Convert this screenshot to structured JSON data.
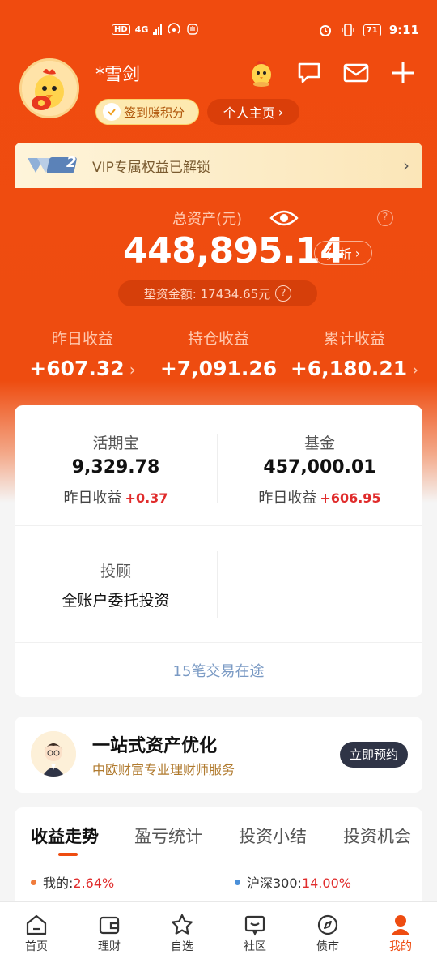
{
  "status_bar": {
    "hd": "HD",
    "network": "4G",
    "time": "9:11",
    "battery": "71"
  },
  "header": {
    "username": "*雪剑",
    "checkin_label": "签到赚积分",
    "profile_label": "个人主页"
  },
  "vip": {
    "level": "2",
    "text": "VIP专属权益已解锁"
  },
  "assets": {
    "total_label": "总资产(元)",
    "total_value": "448,895.14",
    "analyze_label": "分析",
    "margin_text": "垫资金额: 17434.65元",
    "yesterday_label": "昨日收益",
    "yesterday_value": "+607.32",
    "holding_label": "持仓收益",
    "holding_value": "+7,091.26",
    "cumulative_label": "累计收益",
    "cumulative_value": "+6,180.21"
  },
  "products": {
    "huoqibao": {
      "title": "活期宝",
      "value": "9,329.78",
      "sub_label": "昨日收益",
      "sub_value": "+0.37"
    },
    "fund": {
      "title": "基金",
      "value": "457,000.01",
      "sub_label": "昨日收益",
      "sub_value": "+606.95"
    },
    "advisory": {
      "title": "投顾",
      "value": "全账户委托投资"
    },
    "transit": "15笔交易在途"
  },
  "advisor": {
    "title": "一站式资产优化",
    "subtitle": "中欧财富专业理财师服务",
    "button": "立即预约"
  },
  "tabs": [
    "收益走势",
    "盈亏统计",
    "投资小结",
    "投资机会"
  ],
  "legend": {
    "mine_label": "我的:",
    "mine_value": "2.64%",
    "mine_color": "#f07c3c",
    "index_label": "沪深300:",
    "index_value": "14.00%",
    "index_color": "#4a90d9"
  },
  "colors": {
    "brand": "#ee4c10",
    "profit_red": "#e02c2c"
  },
  "nav": [
    {
      "label": "首页",
      "icon": "home-icon"
    },
    {
      "label": "理财",
      "icon": "wallet-icon"
    },
    {
      "label": "自选",
      "icon": "star-icon"
    },
    {
      "label": "社区",
      "icon": "chat-icon"
    },
    {
      "label": "债市",
      "icon": "compass-icon"
    },
    {
      "label": "我的",
      "icon": "person-icon"
    }
  ]
}
